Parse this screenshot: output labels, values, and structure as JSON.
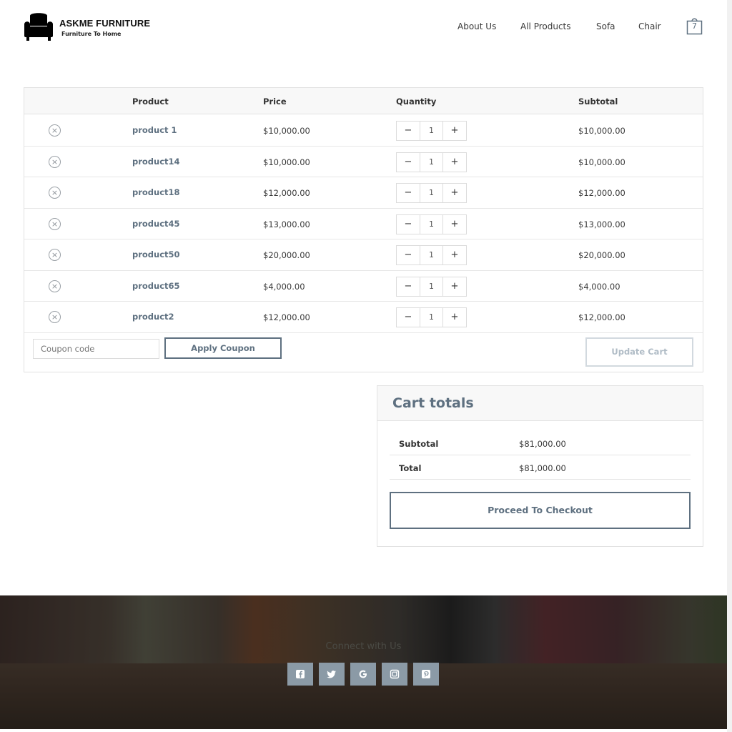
{
  "brand": {
    "title": "ASKME FURNITURE",
    "tagline": "Furniture To Home",
    "logo_icon": "armchair-icon"
  },
  "nav": {
    "items": [
      {
        "label": "About Us"
      },
      {
        "label": "All Products"
      },
      {
        "label": "Sofa"
      },
      {
        "label": "Chair"
      }
    ],
    "cart_count": "7",
    "cart_icon": "shopping-bag-icon"
  },
  "cart": {
    "headers": {
      "product": "Product",
      "price": "Price",
      "quantity": "Quantity",
      "subtotal": "Subtotal"
    },
    "rows": [
      {
        "name": "product 1",
        "price": "$10,000.00",
        "qty": "1",
        "subtotal": "$10,000.00"
      },
      {
        "name": "product14",
        "price": "$10,000.00",
        "qty": "1",
        "subtotal": "$10,000.00"
      },
      {
        "name": "product18",
        "price": "$12,000.00",
        "qty": "1",
        "subtotal": "$12,000.00"
      },
      {
        "name": "product45",
        "price": "$13,000.00",
        "qty": "1",
        "subtotal": "$13,000.00"
      },
      {
        "name": "product50",
        "price": "$20,000.00",
        "qty": "1",
        "subtotal": "$20,000.00"
      },
      {
        "name": "product65",
        "price": "$4,000.00",
        "qty": "1",
        "subtotal": "$4,000.00"
      },
      {
        "name": "product2",
        "price": "$12,000.00",
        "qty": "1",
        "subtotal": "$12,000.00"
      }
    ],
    "qty_minus": "−",
    "qty_plus": "+",
    "remove_symbol": "×",
    "coupon_placeholder": "Coupon code",
    "apply_coupon_label": "Apply Coupon",
    "update_cart_label": "Update Cart"
  },
  "totals": {
    "title": "Cart totals",
    "subtotal_label": "Subtotal",
    "subtotal_value": "$81,000.00",
    "total_label": "Total",
    "total_value": "$81,000.00",
    "checkout_label": "Proceed To Checkout"
  },
  "footer": {
    "connect_text": "Connect with Us",
    "social": [
      {
        "icon": "facebook-icon"
      },
      {
        "icon": "twitter-icon"
      },
      {
        "icon": "google-icon"
      },
      {
        "icon": "instagram-icon"
      },
      {
        "icon": "pinterest-icon"
      }
    ]
  },
  "colors": {
    "accent": "#5e7080",
    "social_bg": "#8b9aa6",
    "update_border": "#d2d9df"
  }
}
